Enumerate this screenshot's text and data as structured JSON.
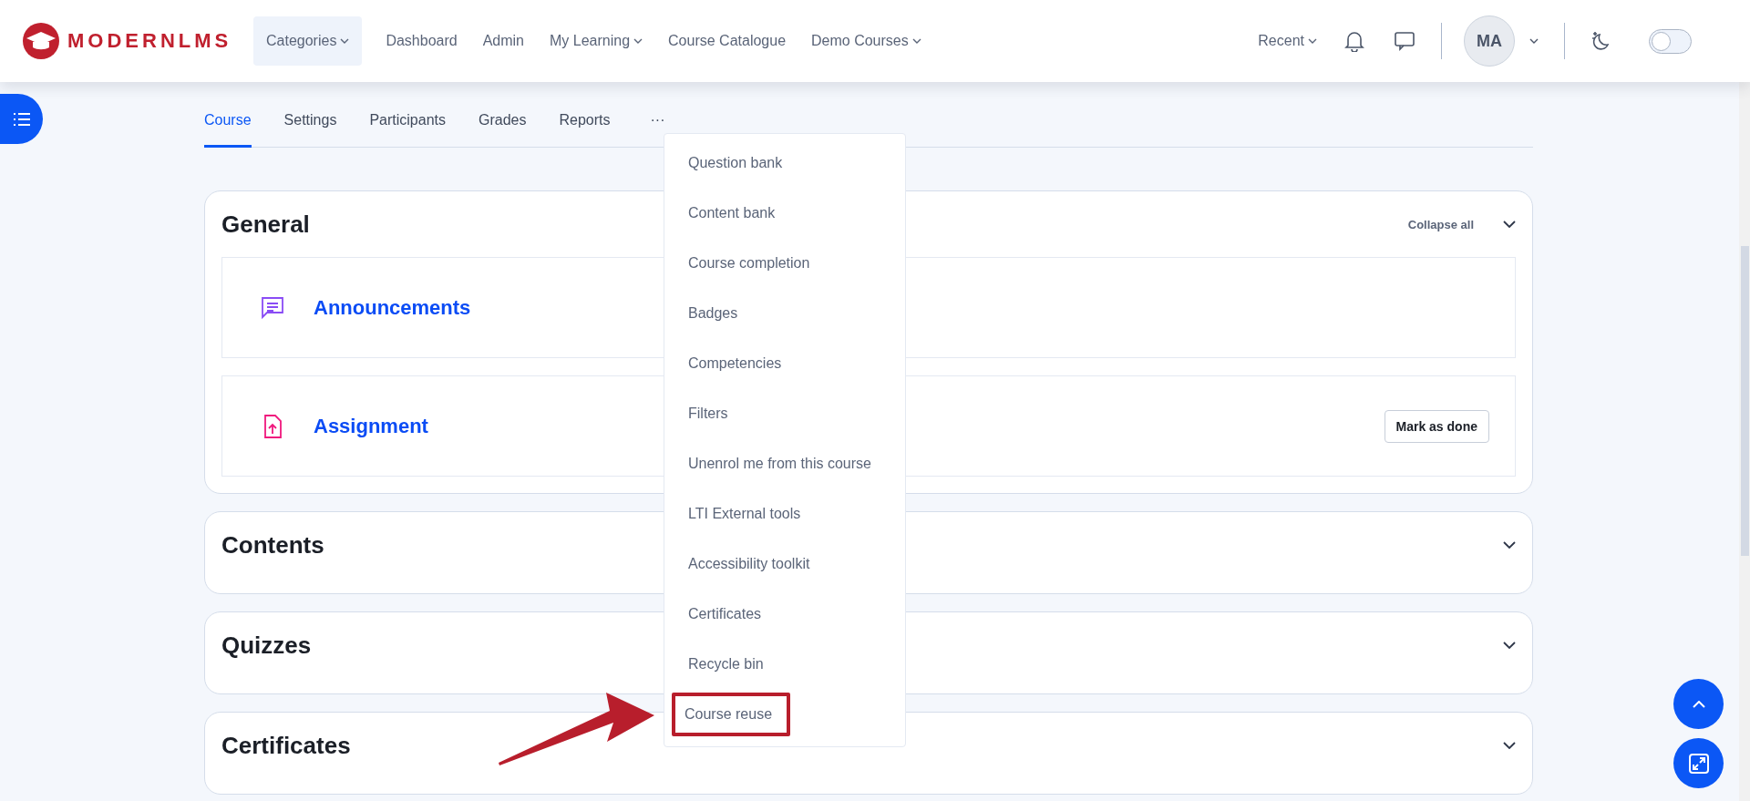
{
  "header": {
    "logo": "MODERNLMS",
    "nav": [
      {
        "label": "Categories",
        "dropdown": true,
        "selected": true
      },
      {
        "label": "Dashboard",
        "dropdown": false,
        "selected": false
      },
      {
        "label": "Admin",
        "dropdown": false,
        "selected": false
      },
      {
        "label": "My Learning",
        "dropdown": true,
        "selected": false
      },
      {
        "label": "Course Catalogue",
        "dropdown": false,
        "selected": false
      },
      {
        "label": "Demo Courses",
        "dropdown": true,
        "selected": false
      }
    ],
    "recent": "Recent",
    "avatar": "MA",
    "theme_toggle": {
      "on": false
    }
  },
  "tabs": [
    {
      "label": "Course",
      "selected": true
    },
    {
      "label": "Settings",
      "selected": false
    },
    {
      "label": "Participants",
      "selected": false
    },
    {
      "label": "Grades",
      "selected": false
    },
    {
      "label": "Reports",
      "selected": false
    },
    {
      "label": "···",
      "selected": false
    }
  ],
  "more_menu": [
    {
      "label": "Question bank",
      "annotated": false
    },
    {
      "label": "Content bank",
      "annotated": false
    },
    {
      "label": "Course completion",
      "annotated": false
    },
    {
      "label": "Badges",
      "annotated": false
    },
    {
      "label": "Competencies",
      "annotated": false
    },
    {
      "label": "Filters",
      "annotated": false
    },
    {
      "label": "Unenrol me from this course",
      "annotated": false
    },
    {
      "label": "LTI External tools",
      "annotated": false
    },
    {
      "label": "Accessibility toolkit",
      "annotated": false
    },
    {
      "label": "Certificates",
      "annotated": false
    },
    {
      "label": "Recycle bin",
      "annotated": false
    },
    {
      "label": "Course reuse",
      "annotated": true
    }
  ],
  "sections": [
    {
      "title": "General",
      "collapse_all": "Collapse all",
      "activities": [
        {
          "kind": "forum",
          "title": "Announcements"
        },
        {
          "kind": "assignment",
          "title": "Assignment",
          "button": "Mark as done"
        }
      ]
    },
    {
      "title": "Contents"
    },
    {
      "title": "Quizzes"
    },
    {
      "title": "Certificates"
    }
  ]
}
